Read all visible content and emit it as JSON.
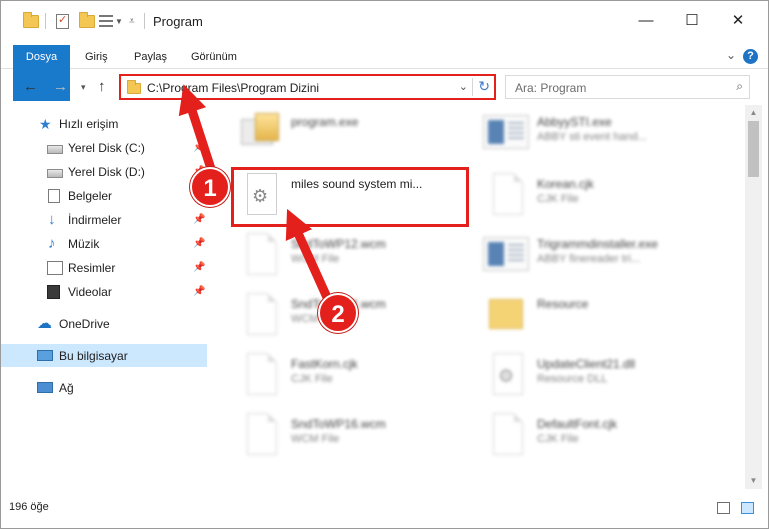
{
  "window": {
    "title": "Program"
  },
  "ribbon": {
    "tabs": [
      "Dosya",
      "Giriş",
      "Paylaş",
      "Görünüm"
    ],
    "help": "?"
  },
  "address": {
    "path": "C:\\Program Files\\Program Dizini"
  },
  "search": {
    "placeholder": "Ara: Program"
  },
  "sidebar": {
    "items": [
      {
        "label": "Hızlı erişim",
        "icon": "star-icon"
      },
      {
        "label": "Yerel Disk (C:)",
        "icon": "drive-icon"
      },
      {
        "label": "Yerel Disk (D:)",
        "icon": "drive-icon"
      },
      {
        "label": "Belgeler",
        "icon": "documents-icon"
      },
      {
        "label": "İndirmeler",
        "icon": "download-icon"
      },
      {
        "label": "Müzik",
        "icon": "music-icon"
      },
      {
        "label": "Resimler",
        "icon": "pictures-icon"
      },
      {
        "label": "Videolar",
        "icon": "videos-icon"
      },
      {
        "label": "OneDrive",
        "icon": "cloud-icon"
      },
      {
        "label": "Bu bilgisayar",
        "icon": "pc-icon"
      },
      {
        "label": "Ağ",
        "icon": "network-icon"
      }
    ]
  },
  "files": [
    {
      "name": "program.exe",
      "sub": ""
    },
    {
      "name": "AbbyySTI.exe",
      "sub": "ABBY sti event hand..."
    },
    {
      "name": "miles sound system mi...",
      "sub": ""
    },
    {
      "name": "Korean.cjk",
      "sub": "CJK File"
    },
    {
      "name": "SndToWP12.wcm",
      "sub": "WCM File"
    },
    {
      "name": "Trigrammdinstaller.exe",
      "sub": "ABBY finereader tri..."
    },
    {
      "name": "SndToWP14.wcm",
      "sub": "WCM File"
    },
    {
      "name": "Resource",
      "sub": ""
    },
    {
      "name": "FastKorn.cjk",
      "sub": "CJK File"
    },
    {
      "name": "UpdateClient21.dll",
      "sub": "Resource DLL"
    },
    {
      "name": "SndToWP16.wcm",
      "sub": "WCM File"
    },
    {
      "name": "DefaultFont.cjk",
      "sub": "CJK File"
    }
  ],
  "status": {
    "count": "196 öğe"
  },
  "annotations": {
    "step1": "1",
    "step2": "2"
  },
  "colors": {
    "accent": "#1979ca",
    "highlight": "#e3201b",
    "selection": "#cce8ff"
  }
}
